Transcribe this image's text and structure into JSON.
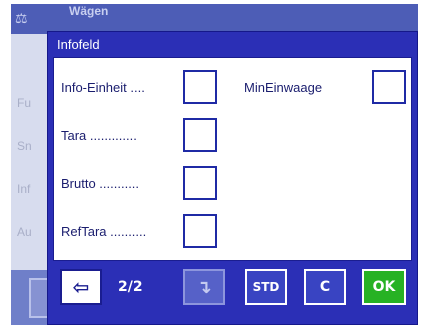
{
  "background": {
    "title": "Wägen",
    "rows": [
      "Fu",
      "Sn",
      "Inf",
      "Au"
    ]
  },
  "dialog": {
    "title": "Infofeld",
    "fields_left": [
      {
        "label": "Info-Einheit ...."
      },
      {
        "label": "Tara ............."
      },
      {
        "label": "Brutto ..........."
      },
      {
        "label": "RefTara .........."
      }
    ],
    "fields_right": [
      {
        "label": "MinEinwaage"
      }
    ],
    "footer": {
      "prev_icon": "arrow-left-icon",
      "page": "2/2",
      "next_icon": "arrow-right-down-icon",
      "std": "STD",
      "c": "C",
      "ok": "OK"
    }
  },
  "colors": {
    "dialog_bg": "#2b2fb6",
    "ok_green": "#27b224"
  }
}
